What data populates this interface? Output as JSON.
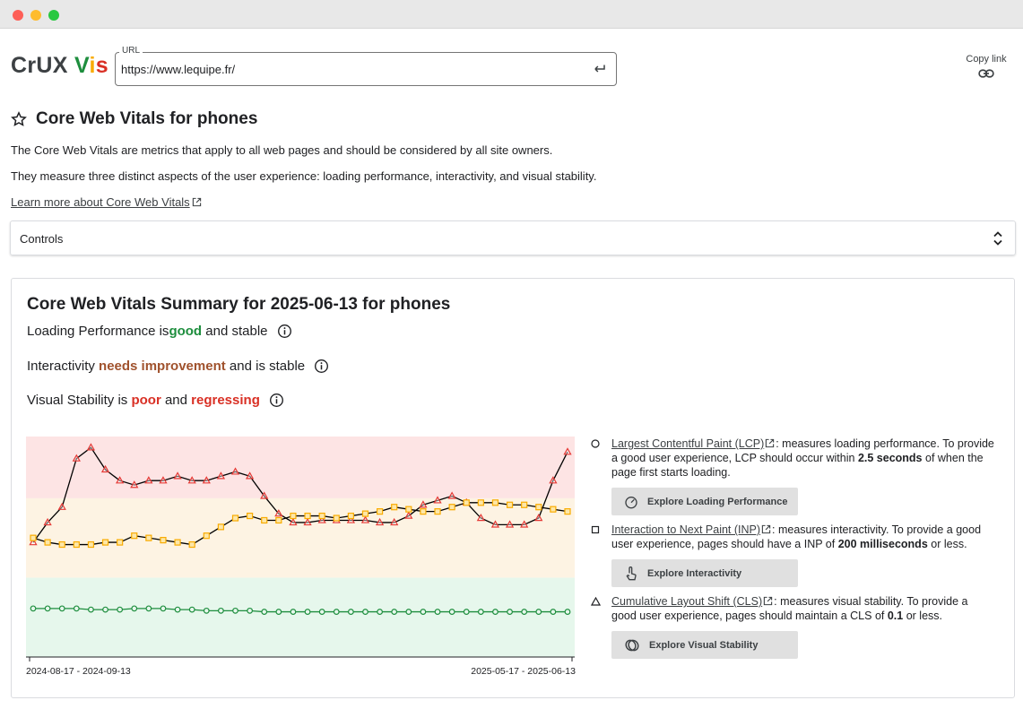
{
  "header": {
    "logo": {
      "crux": "CrUX",
      "v": "V",
      "i": "i",
      "s": "s"
    },
    "url_label": "URL",
    "url_value": "https://www.lequipe.fr/",
    "copy_link": "Copy link"
  },
  "intro": {
    "title": "Core Web Vitals for phones",
    "para1": "The Core Web Vitals are metrics that apply to all web pages and should be considered by all site owners.",
    "para2": "They measure three distinct aspects of the user experience: loading performance, interactivity, and visual stability.",
    "learn_more": "Learn more about Core Web Vitals"
  },
  "controls": {
    "label": "Controls"
  },
  "summary": {
    "title": "Core Web Vitals Summary for 2025-06-13 for phones",
    "lines": [
      {
        "prefix": "Loading Performance is ",
        "rating": "good",
        "mid": " and ",
        "trend": "stable",
        "suffix": ""
      },
      {
        "prefix": "Interactivity ",
        "rating": "needs improvement",
        "mid": " and is ",
        "trend": "stable",
        "suffix": ""
      },
      {
        "prefix": "Visual Stability is ",
        "rating": "poor",
        "mid": " and ",
        "trend": "regressing",
        "suffix": ""
      }
    ],
    "colors": {
      "good": "#1e8e3e",
      "needs_improvement": "#a0522d",
      "poor": "#d93025"
    }
  },
  "metrics": [
    {
      "marker": "circle",
      "name": "Largest Contentful Paint (LCP)",
      "desc_a": ": measures loading performance. To provide a good user experience, LCP should occur within ",
      "threshold": "2.5 seconds",
      "desc_b": " of when the page first starts loading.",
      "button": "Explore Loading Performance",
      "button_icon": "speedometer-icon"
    },
    {
      "marker": "square",
      "name": "Interaction to Next Paint (INP)",
      "desc_a": ": measures interactivity. To provide a good user experience, pages should have a INP of ",
      "threshold": "200 milliseconds",
      "desc_b": " or less.",
      "button": "Explore Interactivity",
      "button_icon": "touch-icon"
    },
    {
      "marker": "triangle",
      "name": "Cumulative Layout Shift (CLS)",
      "desc_a": ": measures visual stability. To provide a good user experience, pages should maintain a CLS of ",
      "threshold": "0.1",
      "desc_b": " or less.",
      "button": "Explore Visual Stability",
      "button_icon": "layers-icon"
    }
  ],
  "chart_data": {
    "type": "line",
    "x_first_label": "2024-08-17 - 2024-09-13",
    "x_last_label": "2025-05-17 - 2025-06-13",
    "ylim": [
      0,
      100
    ],
    "bands": [
      {
        "name": "good",
        "from": 0,
        "to": 36,
        "color": "#e6f7ec"
      },
      {
        "name": "needs improvement",
        "from": 36,
        "to": 72,
        "color": "#fdf3e3"
      },
      {
        "name": "poor",
        "from": 72,
        "to": 100,
        "color": "#fde4e4"
      }
    ],
    "grid": false,
    "legend": "none",
    "series": [
      {
        "marker": "triangle",
        "color": "#e53935",
        "line": "#000000",
        "values": [
          52,
          61,
          68,
          90,
          95,
          85,
          80,
          78,
          80,
          80,
          82,
          80,
          80,
          82,
          84,
          82,
          73,
          65,
          61,
          61,
          62,
          62,
          62,
          62,
          61,
          61,
          64,
          69,
          71,
          73,
          70,
          63,
          60,
          60,
          60,
          63,
          80,
          93
        ]
      },
      {
        "marker": "square",
        "color": "#f9ab00",
        "line": "#000000",
        "values": [
          54,
          52,
          51,
          51,
          51,
          52,
          52,
          55,
          54,
          53,
          52,
          51,
          55,
          59,
          63,
          64,
          62,
          62,
          64,
          64,
          64,
          63,
          64,
          65,
          66,
          68,
          67,
          66,
          66,
          68,
          70,
          70,
          70,
          69,
          69,
          68,
          67,
          66
        ]
      },
      {
        "marker": "circle",
        "color": "#1e8e3e",
        "line": "#1e8e3e",
        "values": [
          22,
          22,
          22,
          22,
          21.5,
          21.5,
          21.5,
          22,
          22,
          22,
          21.5,
          21.5,
          21,
          21,
          21,
          21,
          20.5,
          20.5,
          20.5,
          20.5,
          20.5,
          20.5,
          20.5,
          20.5,
          20.5,
          20.5,
          20.5,
          20.5,
          20.5,
          20.5,
          20.5,
          20.5,
          20.5,
          20.5,
          20.5,
          20.5,
          20.5,
          20.5
        ]
      }
    ]
  }
}
